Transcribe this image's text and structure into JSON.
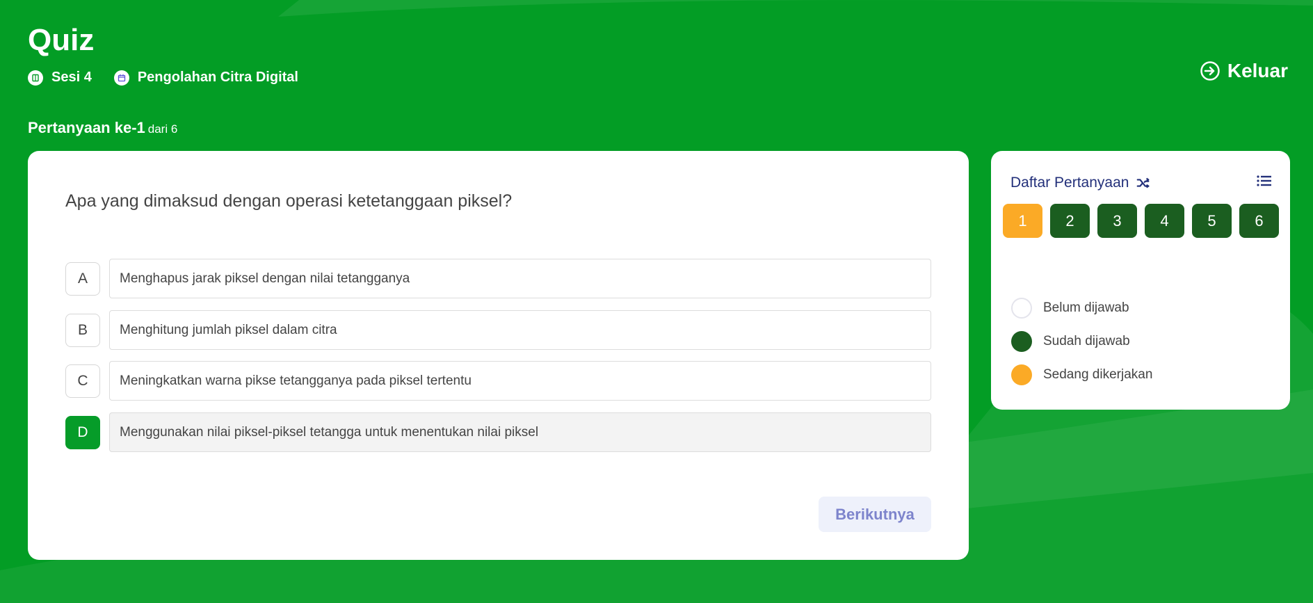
{
  "header": {
    "title": "Quiz",
    "session": "Sesi 4",
    "course": "Pengolahan Citra Digital",
    "exit_label": "Keluar"
  },
  "counter": {
    "main": "Pertanyaan ke-1",
    "sub": "dari 6"
  },
  "question": {
    "text": "Apa yang dimaksud dengan operasi ketetanggaan piksel?",
    "options": [
      {
        "letter": "A",
        "text": "Menghapus jarak piksel dengan nilai tetangganya",
        "selected": false
      },
      {
        "letter": "B",
        "text": "Menghitung jumlah piksel dalam citra",
        "selected": false
      },
      {
        "letter": "C",
        "text": "Meningkatkan warna pikse tetangganya pada piksel tertentu",
        "selected": false
      },
      {
        "letter": "D",
        "text": "Menggunakan nilai piksel-piksel tetangga untuk menentukan nilai piksel",
        "selected": true
      }
    ],
    "next_label": "Berikutnya"
  },
  "sidebar": {
    "title": "Daftar Pertanyaan",
    "numbers": [
      "1",
      "2",
      "3",
      "4",
      "5",
      "6"
    ],
    "current": "1",
    "legend": {
      "unanswered": "Belum dijawab",
      "answered": "Sudah dijawab",
      "in_progress": "Sedang dikerjakan"
    }
  },
  "colors": {
    "background": "#039d25",
    "selected_option": "#069c29",
    "answered": "#1b5e20",
    "current": "#fbaa26",
    "sidebar_title": "#23307a",
    "next_button_text": "#7d84cc"
  }
}
